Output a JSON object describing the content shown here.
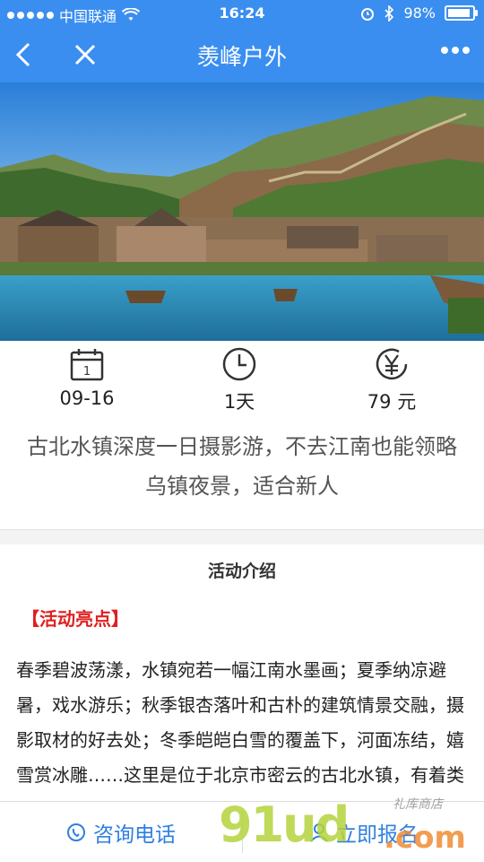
{
  "status_bar": {
    "carrier": "中国联通",
    "time": "16:24",
    "battery": "98%"
  },
  "nav": {
    "title": "羡峰户外",
    "back_icon": "chevron-left-icon",
    "close_icon": "close-icon",
    "more_icon": "more-dots-icon"
  },
  "info": {
    "date": "09-16",
    "duration": "1天",
    "price": "79 元"
  },
  "summary": "古北水镇深度一日摄影游，不去江南也能领略乌镇夜景，适合新人",
  "section_title": "活动介绍",
  "highlight_label": "【活动亮点】",
  "body_text": "春季碧波荡漾，水镇宛若一幅江南水墨画；夏季纳凉避暑，戏水游乐；秋季银杏落叶和古朴的建筑情景交融，摄影取材的好去处；冬季皑皑白雪的覆盖下，河面冻结，嬉雪赏冰雕……这里是位于北京市密云的古北水镇，有着类江南乌镇的悠",
  "bottom_bar": {
    "consult_label": "咨询电话",
    "signup_label": "立即报名"
  },
  "watermark": {
    "main": "91ud",
    "com": ".com",
    "sub": "礼库商店"
  },
  "colors": {
    "nav_bg": "#3a8ef0",
    "accent_blue": "#2f7fe0",
    "highlight_red": "#e02020"
  }
}
